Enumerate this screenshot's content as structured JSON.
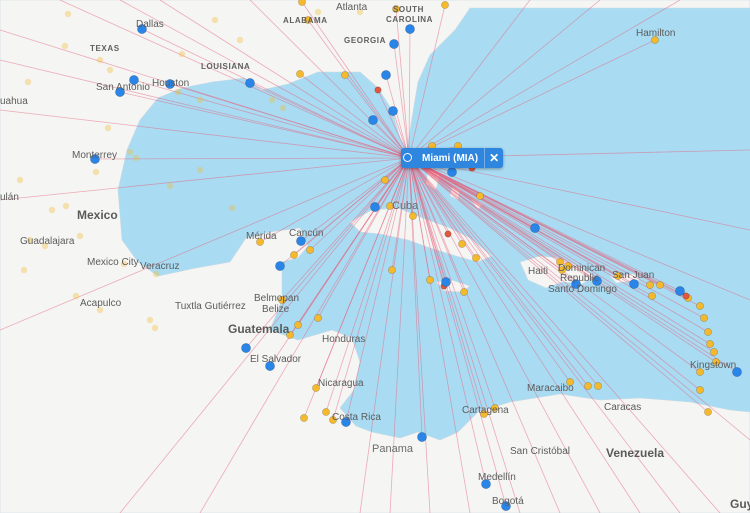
{
  "colors": {
    "water": "#a9dcf3",
    "land": "#f5f5f3",
    "route": "#e6607a",
    "major_airport": "#2a85e8",
    "minor_airport": "#f4b92c",
    "red_airport": "#e2573d"
  },
  "selected_airport": {
    "label": "Miami (MIA)",
    "close_icon": "close-icon",
    "close_glyph": "✕"
  },
  "labels": [
    {
      "text": "ALABAMA",
      "kind": "state"
    },
    {
      "text": "SOUTH",
      "kind": "state"
    },
    {
      "text": "CAROLINA",
      "kind": "state"
    },
    {
      "text": "GEORGIA",
      "kind": "state"
    },
    {
      "text": "TEXAS",
      "kind": "state"
    },
    {
      "text": "LOUISIANA",
      "kind": "state"
    },
    {
      "text": "Mexico",
      "kind": "country"
    },
    {
      "text": "Cuba",
      "kind": "country"
    },
    {
      "text": "Guatemala",
      "kind": "country"
    },
    {
      "text": "Venezuela",
      "kind": "country"
    },
    {
      "text": "Haiti",
      "kind": "city"
    },
    {
      "text": "Dominican",
      "kind": "city"
    },
    {
      "text": "Republic",
      "kind": "city"
    },
    {
      "text": "Honduras",
      "kind": "city"
    },
    {
      "text": "Nicaragua",
      "kind": "city"
    },
    {
      "text": "El Salvador",
      "kind": "city"
    },
    {
      "text": "Costa Rica",
      "kind": "city"
    },
    {
      "text": "Panama",
      "kind": "country"
    },
    {
      "text": "Belize",
      "kind": "city"
    },
    {
      "text": "Dallas",
      "kind": "city"
    },
    {
      "text": "Atlanta",
      "kind": "city"
    },
    {
      "text": "Houston",
      "kind": "city"
    },
    {
      "text": "San Antonio",
      "kind": "city"
    },
    {
      "text": "Monterrey",
      "kind": "city"
    },
    {
      "text": "Guadalajara",
      "kind": "city"
    },
    {
      "text": "Mexico City",
      "kind": "city"
    },
    {
      "text": "Veracruz",
      "kind": "city"
    },
    {
      "text": "Acapulco",
      "kind": "city"
    },
    {
      "text": "Tuxtla Gutiérrez",
      "kind": "city"
    },
    {
      "text": "Mérida",
      "kind": "city"
    },
    {
      "text": "Cancún",
      "kind": "city"
    },
    {
      "text": "Belmopan",
      "kind": "city"
    },
    {
      "text": "Maracaibo",
      "kind": "city"
    },
    {
      "text": "Caracas",
      "kind": "city"
    },
    {
      "text": "Cartagena",
      "kind": "city"
    },
    {
      "text": "San Cristóbal",
      "kind": "city"
    },
    {
      "text": "Medellín",
      "kind": "city"
    },
    {
      "text": "Bogotá",
      "kind": "city"
    },
    {
      "text": "Hamilton",
      "kind": "city"
    },
    {
      "text": "Kingstown",
      "kind": "city"
    },
    {
      "text": "Santo Domingo",
      "kind": "city"
    },
    {
      "text": "San Juan",
      "kind": "city"
    },
    {
      "text": "Guy",
      "kind": "country"
    },
    {
      "text": "uahua",
      "kind": "city"
    },
    {
      "text": "ulán",
      "kind": "city"
    }
  ]
}
